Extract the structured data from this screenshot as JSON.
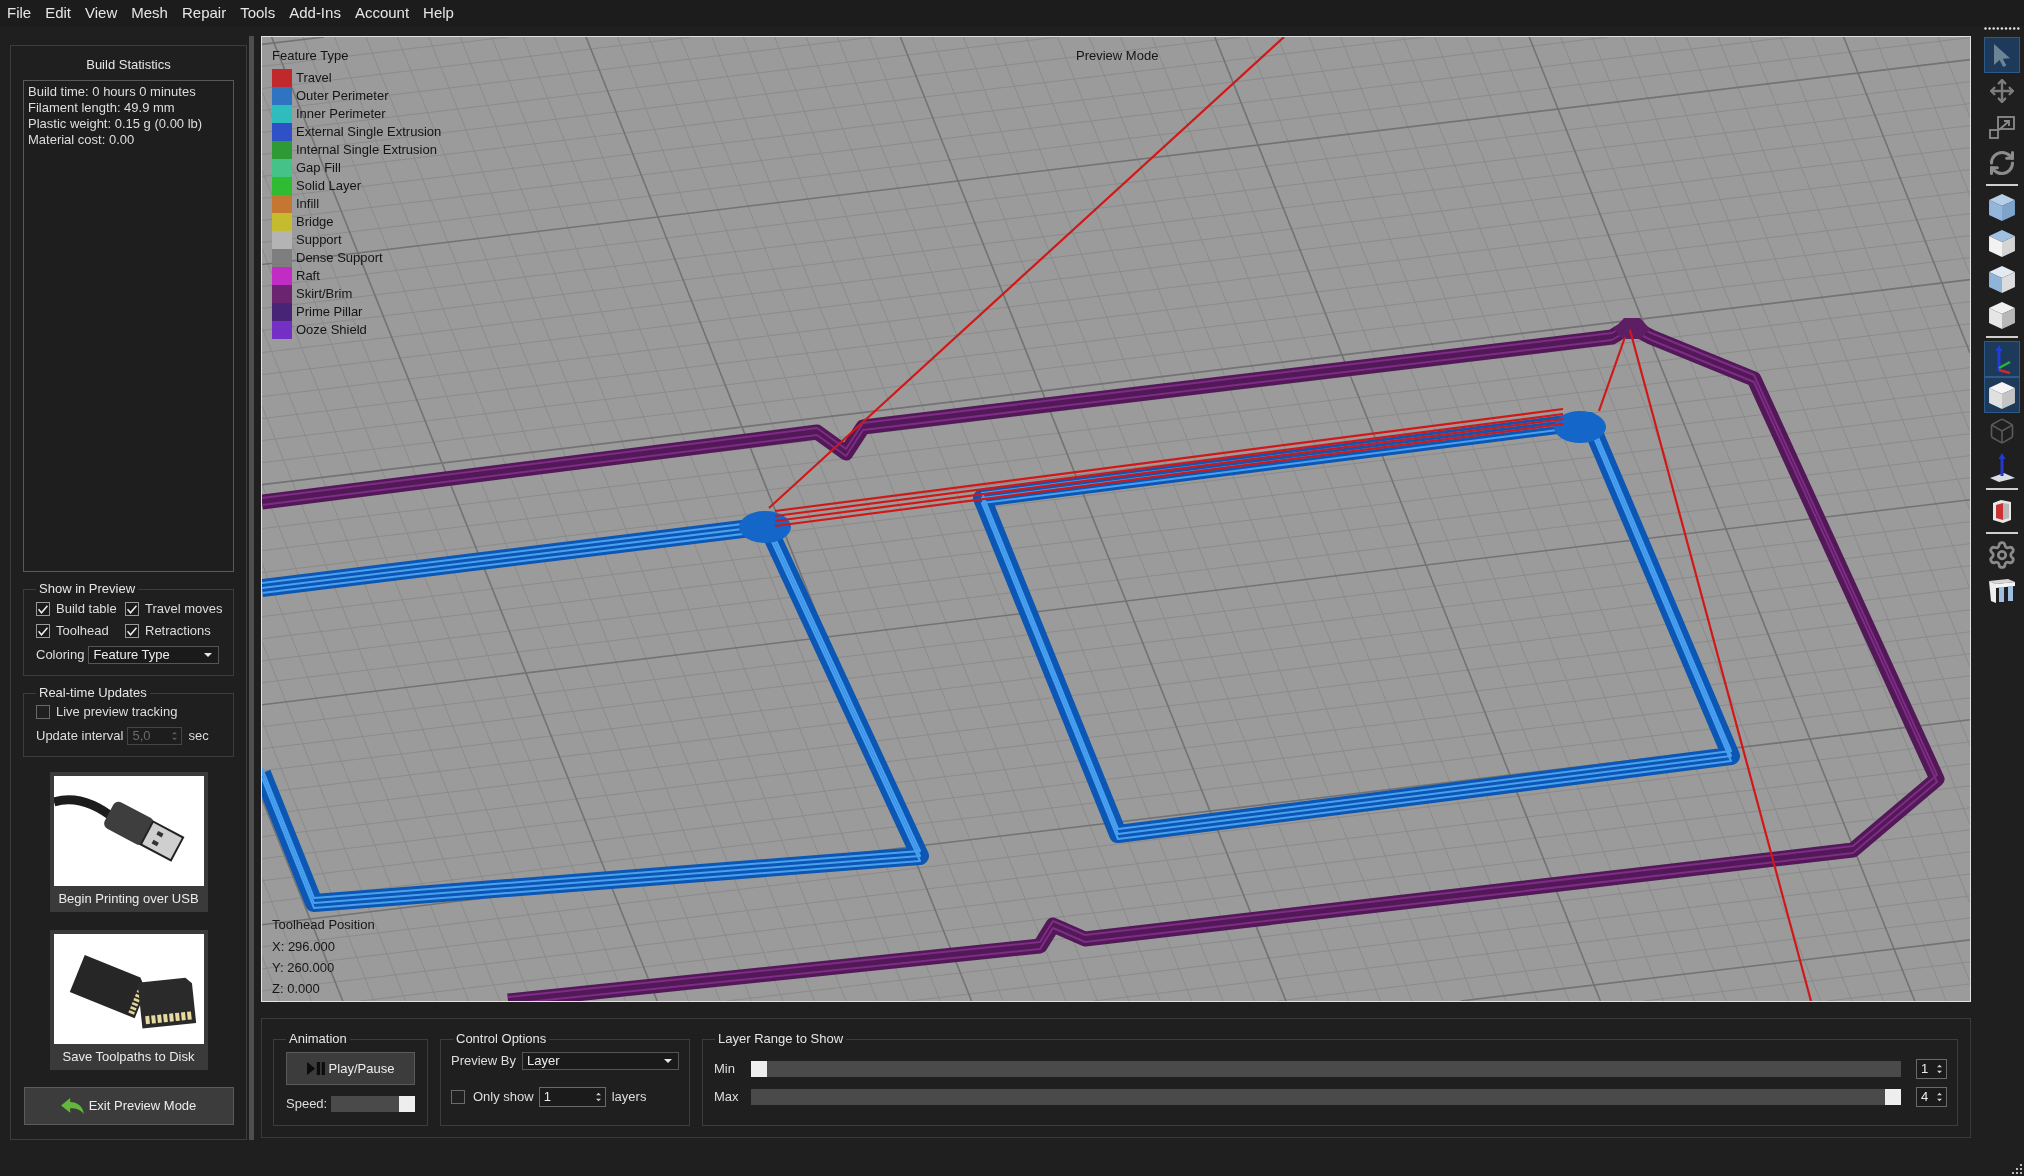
{
  "menu_bar": {
    "items": [
      "File",
      "Edit",
      "View",
      "Mesh",
      "Repair",
      "Tools",
      "Add-Ins",
      "Account",
      "Help"
    ]
  },
  "build_statistics": {
    "title": "Build Statistics",
    "lines": [
      "Build time: 0 hours 0 minutes",
      "Filament length: 49.9 mm",
      "Plastic weight: 0.15 g (0.00 lb)",
      "Material cost: 0.00"
    ]
  },
  "show_in_preview": {
    "title": "Show in Preview",
    "options": [
      {
        "label": "Build table",
        "checked": true
      },
      {
        "label": "Travel moves",
        "checked": true
      },
      {
        "label": "Toolhead",
        "checked": true
      },
      {
        "label": "Retractions",
        "checked": true
      }
    ],
    "coloring": {
      "label": "Coloring",
      "value": "Feature Type"
    }
  },
  "realtime_updates": {
    "title": "Real-time Updates",
    "live_tracking": {
      "label": "Live preview tracking",
      "checked": false
    },
    "update_interval": {
      "label": "Update interval",
      "value": "5,0",
      "unit": "sec",
      "disabled": true
    }
  },
  "output_buttons": [
    {
      "kind": "usb",
      "label": "Begin Printing over USB"
    },
    {
      "kind": "sd_card",
      "label": "Save Toolpaths to Disk"
    }
  ],
  "exit_button": {
    "label": "Exit Preview Mode"
  },
  "viewport": {
    "mode_label": "Preview Mode",
    "legend": {
      "title": "Feature Type",
      "items": [
        {
          "label": "Travel",
          "color": "#c0282c"
        },
        {
          "label": "Outer Perimeter",
          "color": "#2e74c0"
        },
        {
          "label": "Inner Perimeter",
          "color": "#2ebcbc"
        },
        {
          "label": "External Single Extrusion",
          "color": "#2f50c6"
        },
        {
          "label": "Internal Single Extrusion",
          "color": "#2d9a36"
        },
        {
          "label": "Gap Fill",
          "color": "#45c288"
        },
        {
          "label": "Solid Layer",
          "color": "#2fbb32"
        },
        {
          "label": "Infill",
          "color": "#c57632"
        },
        {
          "label": "Bridge",
          "color": "#c4bc2e"
        },
        {
          "label": "Support",
          "color": "#b4b4b4"
        },
        {
          "label": "Dense Support",
          "color": "#7e7e7e"
        },
        {
          "label": "Raft",
          "color": "#c02cc4"
        },
        {
          "label": "Skirt/Brim",
          "color": "#6a2470"
        },
        {
          "label": "Prime Pillar",
          "color": "#482476"
        },
        {
          "label": "Ooze Shield",
          "color": "#7430c4"
        }
      ]
    },
    "toolhead_position": {
      "title": "Toolhead Position",
      "lines": [
        "X: 296.000",
        "Y: 260.000",
        "Z: 0.000"
      ]
    }
  },
  "toolbar": {
    "groups": [
      {
        "items": [
          {
            "kind": "select",
            "selected": true
          },
          {
            "kind": "move",
            "selected": false
          },
          {
            "kind": "scale",
            "selected": false
          },
          {
            "kind": "rotate",
            "selected": false
          }
        ]
      },
      {
        "items": [
          {
            "kind": "view-iso",
            "selected": false
          },
          {
            "kind": "view-top",
            "selected": false
          },
          {
            "kind": "view-front",
            "selected": false
          },
          {
            "kind": "view-side",
            "selected": false
          }
        ]
      },
      {
        "items": [
          {
            "kind": "axes",
            "selected": true
          },
          {
            "kind": "solid",
            "selected": true
          },
          {
            "kind": "wireframe",
            "selected": false
          },
          {
            "kind": "build-plane",
            "selected": false
          }
        ]
      },
      {
        "items": [
          {
            "kind": "section",
            "selected": false
          }
        ]
      },
      {
        "items": [
          {
            "kind": "settings",
            "selected": false
          },
          {
            "kind": "supports",
            "selected": false
          }
        ]
      }
    ]
  },
  "animation": {
    "title": "Animation",
    "play_button": {
      "label": "Play/Pause"
    },
    "speed": {
      "label": "Speed:",
      "level": 1
    }
  },
  "control_options": {
    "title": "Control Options",
    "preview_by": {
      "label": "Preview By",
      "value": "Layer"
    },
    "only_show": {
      "label": "Only show",
      "checked": false,
      "value": "1",
      "unit": "layers"
    }
  },
  "layer_range": {
    "title": "Layer Range to Show",
    "sliders": [
      {
        "label": "Min",
        "level": 0,
        "value": "1"
      },
      {
        "label": "Max",
        "level": 1,
        "value": "4"
      }
    ]
  }
}
